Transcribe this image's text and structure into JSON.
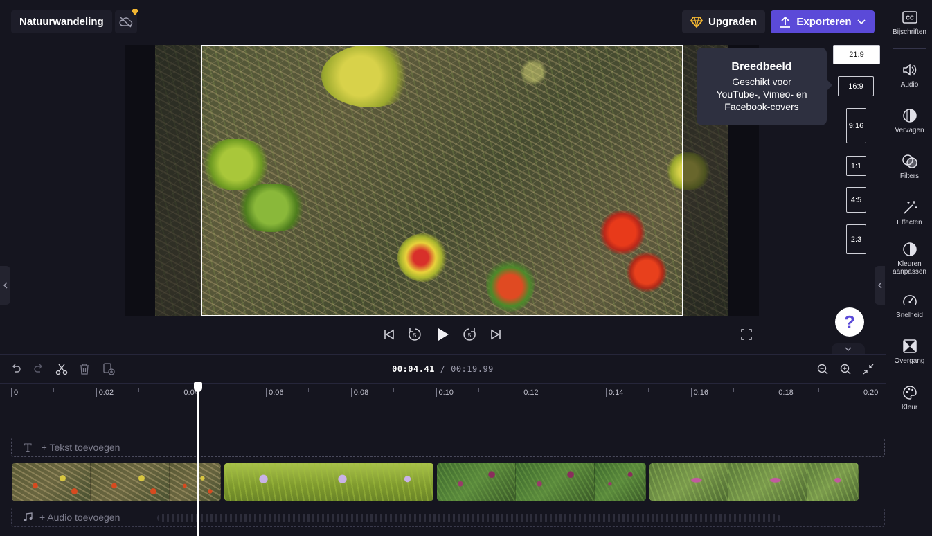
{
  "header": {
    "project_name": "Natuurwandeling",
    "upgrade_label": "Upgraden",
    "export_label": "Exporteren"
  },
  "tooltip": {
    "title": "Breedbeeld",
    "line1": "Geschikt voor",
    "line2": "YouTube-, Vimeo- en",
    "line3": "Facebook-covers"
  },
  "aspect_ratios": [
    {
      "label": "21:9",
      "active": true
    },
    {
      "label": "16:9",
      "active": false
    },
    {
      "label": "9:16",
      "active": false
    },
    {
      "label": "1:1",
      "active": false
    },
    {
      "label": "4:5",
      "active": false
    },
    {
      "label": "2:3",
      "active": false
    }
  ],
  "help_label": "?",
  "sidebar": {
    "items": [
      {
        "label": "Bijschriften",
        "icon": "captions-icon"
      },
      {
        "label": "Audio",
        "icon": "speaker-icon"
      },
      {
        "label": "Vervagen",
        "icon": "fade-icon"
      },
      {
        "label": "Filters",
        "icon": "filters-icon"
      },
      {
        "label": "Effecten",
        "icon": "magic-wand-icon"
      },
      {
        "label": "Kleuren",
        "label2": "aanpassen",
        "icon": "contrast-icon"
      },
      {
        "label": "Snelheid",
        "icon": "speedometer-icon"
      },
      {
        "label": "Overgang",
        "icon": "transition-icon"
      },
      {
        "label": "Kleur",
        "icon": "palette-icon"
      }
    ]
  },
  "timeline": {
    "current_time": "00:04.41",
    "separator": "/",
    "total_time": "00:19.99",
    "ruler_labels": [
      "0",
      "0:02",
      "0:04",
      "0:06",
      "0:08",
      "0:10",
      "0:12",
      "0:14",
      "0:16",
      "0:18",
      "0:20"
    ],
    "text_track_label": "+ Tekst toevoegen",
    "audio_track_label": "+ Audio toevoegen"
  },
  "colors": {
    "accent": "#5b4ad8",
    "background": "#15151f",
    "panel": "#1d1d29"
  }
}
